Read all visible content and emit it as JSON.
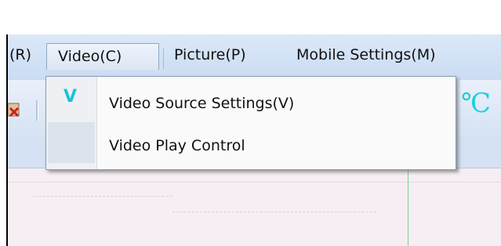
{
  "menubar": {
    "items": [
      {
        "label": "(R)"
      },
      {
        "label": "Video(C)"
      },
      {
        "label": "Picture(P)"
      },
      {
        "label": "Mobile Settings(M)"
      }
    ]
  },
  "video_menu": {
    "items": [
      {
        "label": "Video Source Settings(V)",
        "icon": "V",
        "checked": true
      },
      {
        "label": "Video Play Control",
        "checked": false
      }
    ]
  },
  "toolbar": {
    "temperature_icon": "℃"
  },
  "colors": {
    "menubar_bg": "#cfe0f5",
    "accent_icon": "#18c4d8",
    "content_bg": "#f6eef2"
  }
}
